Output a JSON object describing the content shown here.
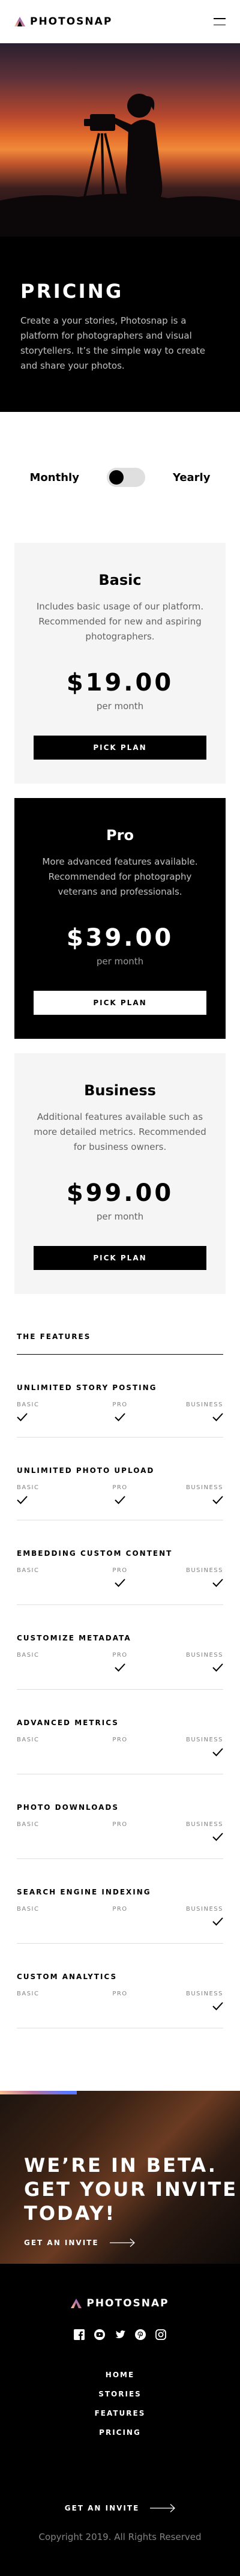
{
  "brand": {
    "name": "PHOTOSNAP"
  },
  "hero": {
    "title": "PRICING",
    "description": "Create a your stories, Photosnap is a platform for photographers and visual storytellers. It’s the simple way to create and share your photos."
  },
  "billing_toggle": {
    "monthly_label": "Monthly",
    "yearly_label": "Yearly",
    "selected": "Monthly"
  },
  "plans": [
    {
      "name": "Basic",
      "description": "Includes basic usage of our platform. Recommended for new and aspiring photographers.",
      "price": "$19.00",
      "period": "per month",
      "button": "PICK PLAN",
      "theme": "light"
    },
    {
      "name": "Pro",
      "description": "More advanced features available. Recommended for photography veterans and professionals.",
      "price": "$39.00",
      "period": "per month",
      "button": "PICK PLAN",
      "theme": "dark"
    },
    {
      "name": "Business",
      "description": "Additional features available such as more detailed metrics. Recommended for business owners.",
      "price": "$99.00",
      "period": "per month",
      "button": "PICK PLAN",
      "theme": "light"
    }
  ],
  "features": {
    "heading": "THE FEATURES",
    "col_labels": {
      "basic": "BASIC",
      "pro": "PRO",
      "business": "BUSINESS"
    },
    "rows": [
      {
        "name": "UNLIMITED STORY POSTING",
        "basic": true,
        "pro": true,
        "business": true
      },
      {
        "name": "UNLIMITED PHOTO UPLOAD",
        "basic": true,
        "pro": true,
        "business": true
      },
      {
        "name": "EMBEDDING CUSTOM CONTENT",
        "basic": false,
        "pro": true,
        "business": true
      },
      {
        "name": "CUSTOMIZE METADATA",
        "basic": false,
        "pro": true,
        "business": true
      },
      {
        "name": "ADVANCED METRICS",
        "basic": false,
        "pro": false,
        "business": true
      },
      {
        "name": "PHOTO DOWNLOADS",
        "basic": false,
        "pro": false,
        "business": true
      },
      {
        "name": "SEARCH ENGINE INDEXING",
        "basic": false,
        "pro": false,
        "business": true
      },
      {
        "name": "CUSTOM ANALYTICS",
        "basic": false,
        "pro": false,
        "business": true
      }
    ]
  },
  "beta": {
    "title_lines": [
      "WE’RE IN BETA.",
      "GET YOUR INVITE",
      "TODAY!"
    ],
    "link": "GET AN INVITE"
  },
  "footer": {
    "socials": [
      "facebook-icon",
      "youtube-icon",
      "twitter-icon",
      "pinterest-icon",
      "instagram-icon"
    ],
    "nav": [
      "HOME",
      "STORIES",
      "FEATURES",
      "PRICING"
    ],
    "cta": "GET AN INVITE",
    "copyright": "Copyright 2019. All Rights Reserved"
  },
  "colors": {
    "gradient_start": "#FFC593",
    "gradient_mid": "#BC7198",
    "gradient_end": "#5A77FF",
    "light_card": "#F5F5F5"
  }
}
